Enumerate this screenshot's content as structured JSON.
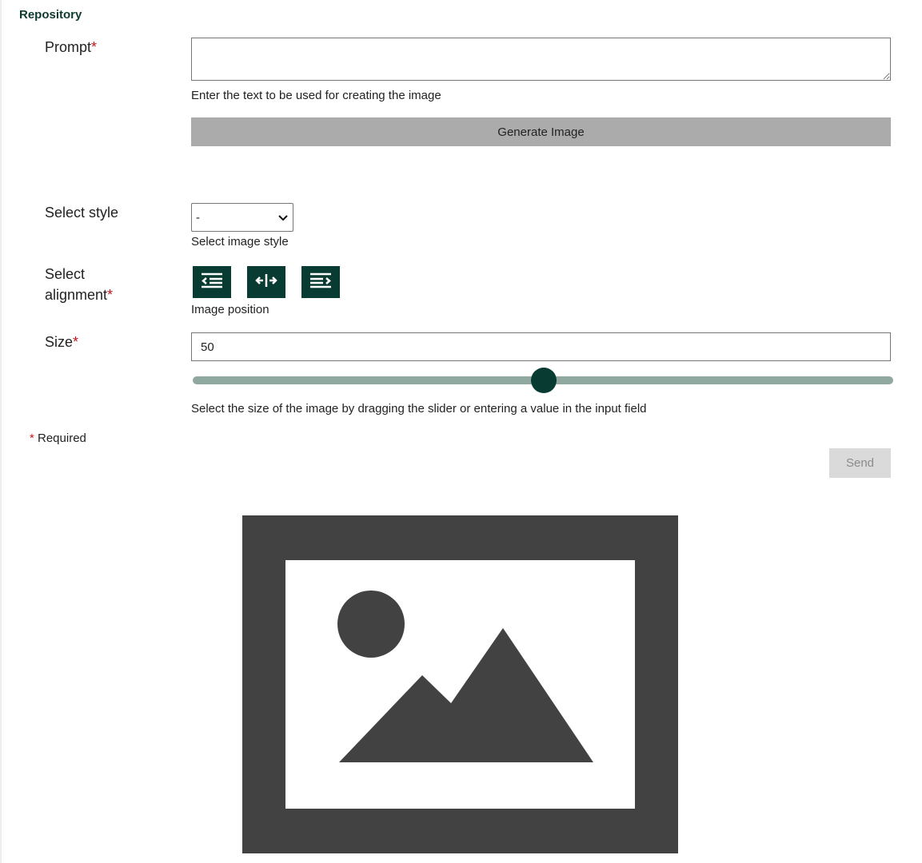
{
  "section": {
    "title": "Repository"
  },
  "prompt": {
    "label": "Prompt",
    "required_marker": "*",
    "value": "",
    "help": "Enter the text to be used for creating the image",
    "generate_label": "Generate Image"
  },
  "style": {
    "label": "Select style",
    "selected": "-",
    "help": "Select image style"
  },
  "alignment": {
    "label_line1": "Select",
    "label_line2": "alignment",
    "required_marker": "*",
    "help": "Image position",
    "options": [
      "align-left-icon",
      "align-center-icon",
      "align-right-icon"
    ]
  },
  "size": {
    "label": "Size",
    "required_marker": "*",
    "value": "50",
    "slider_fraction": 0.5,
    "help": "Select the size of the image by dragging the slider or entering a value in the input field"
  },
  "required_note": {
    "marker": "*",
    "text": " Required"
  },
  "send": {
    "label": "Send"
  },
  "preview": {
    "icon": "image-placeholder-icon"
  },
  "colors": {
    "accent": "#083b31",
    "required": "#c0161b",
    "generate_button": "#ababab",
    "slider_track": "#8fa9a1",
    "placeholder": "#424242"
  }
}
